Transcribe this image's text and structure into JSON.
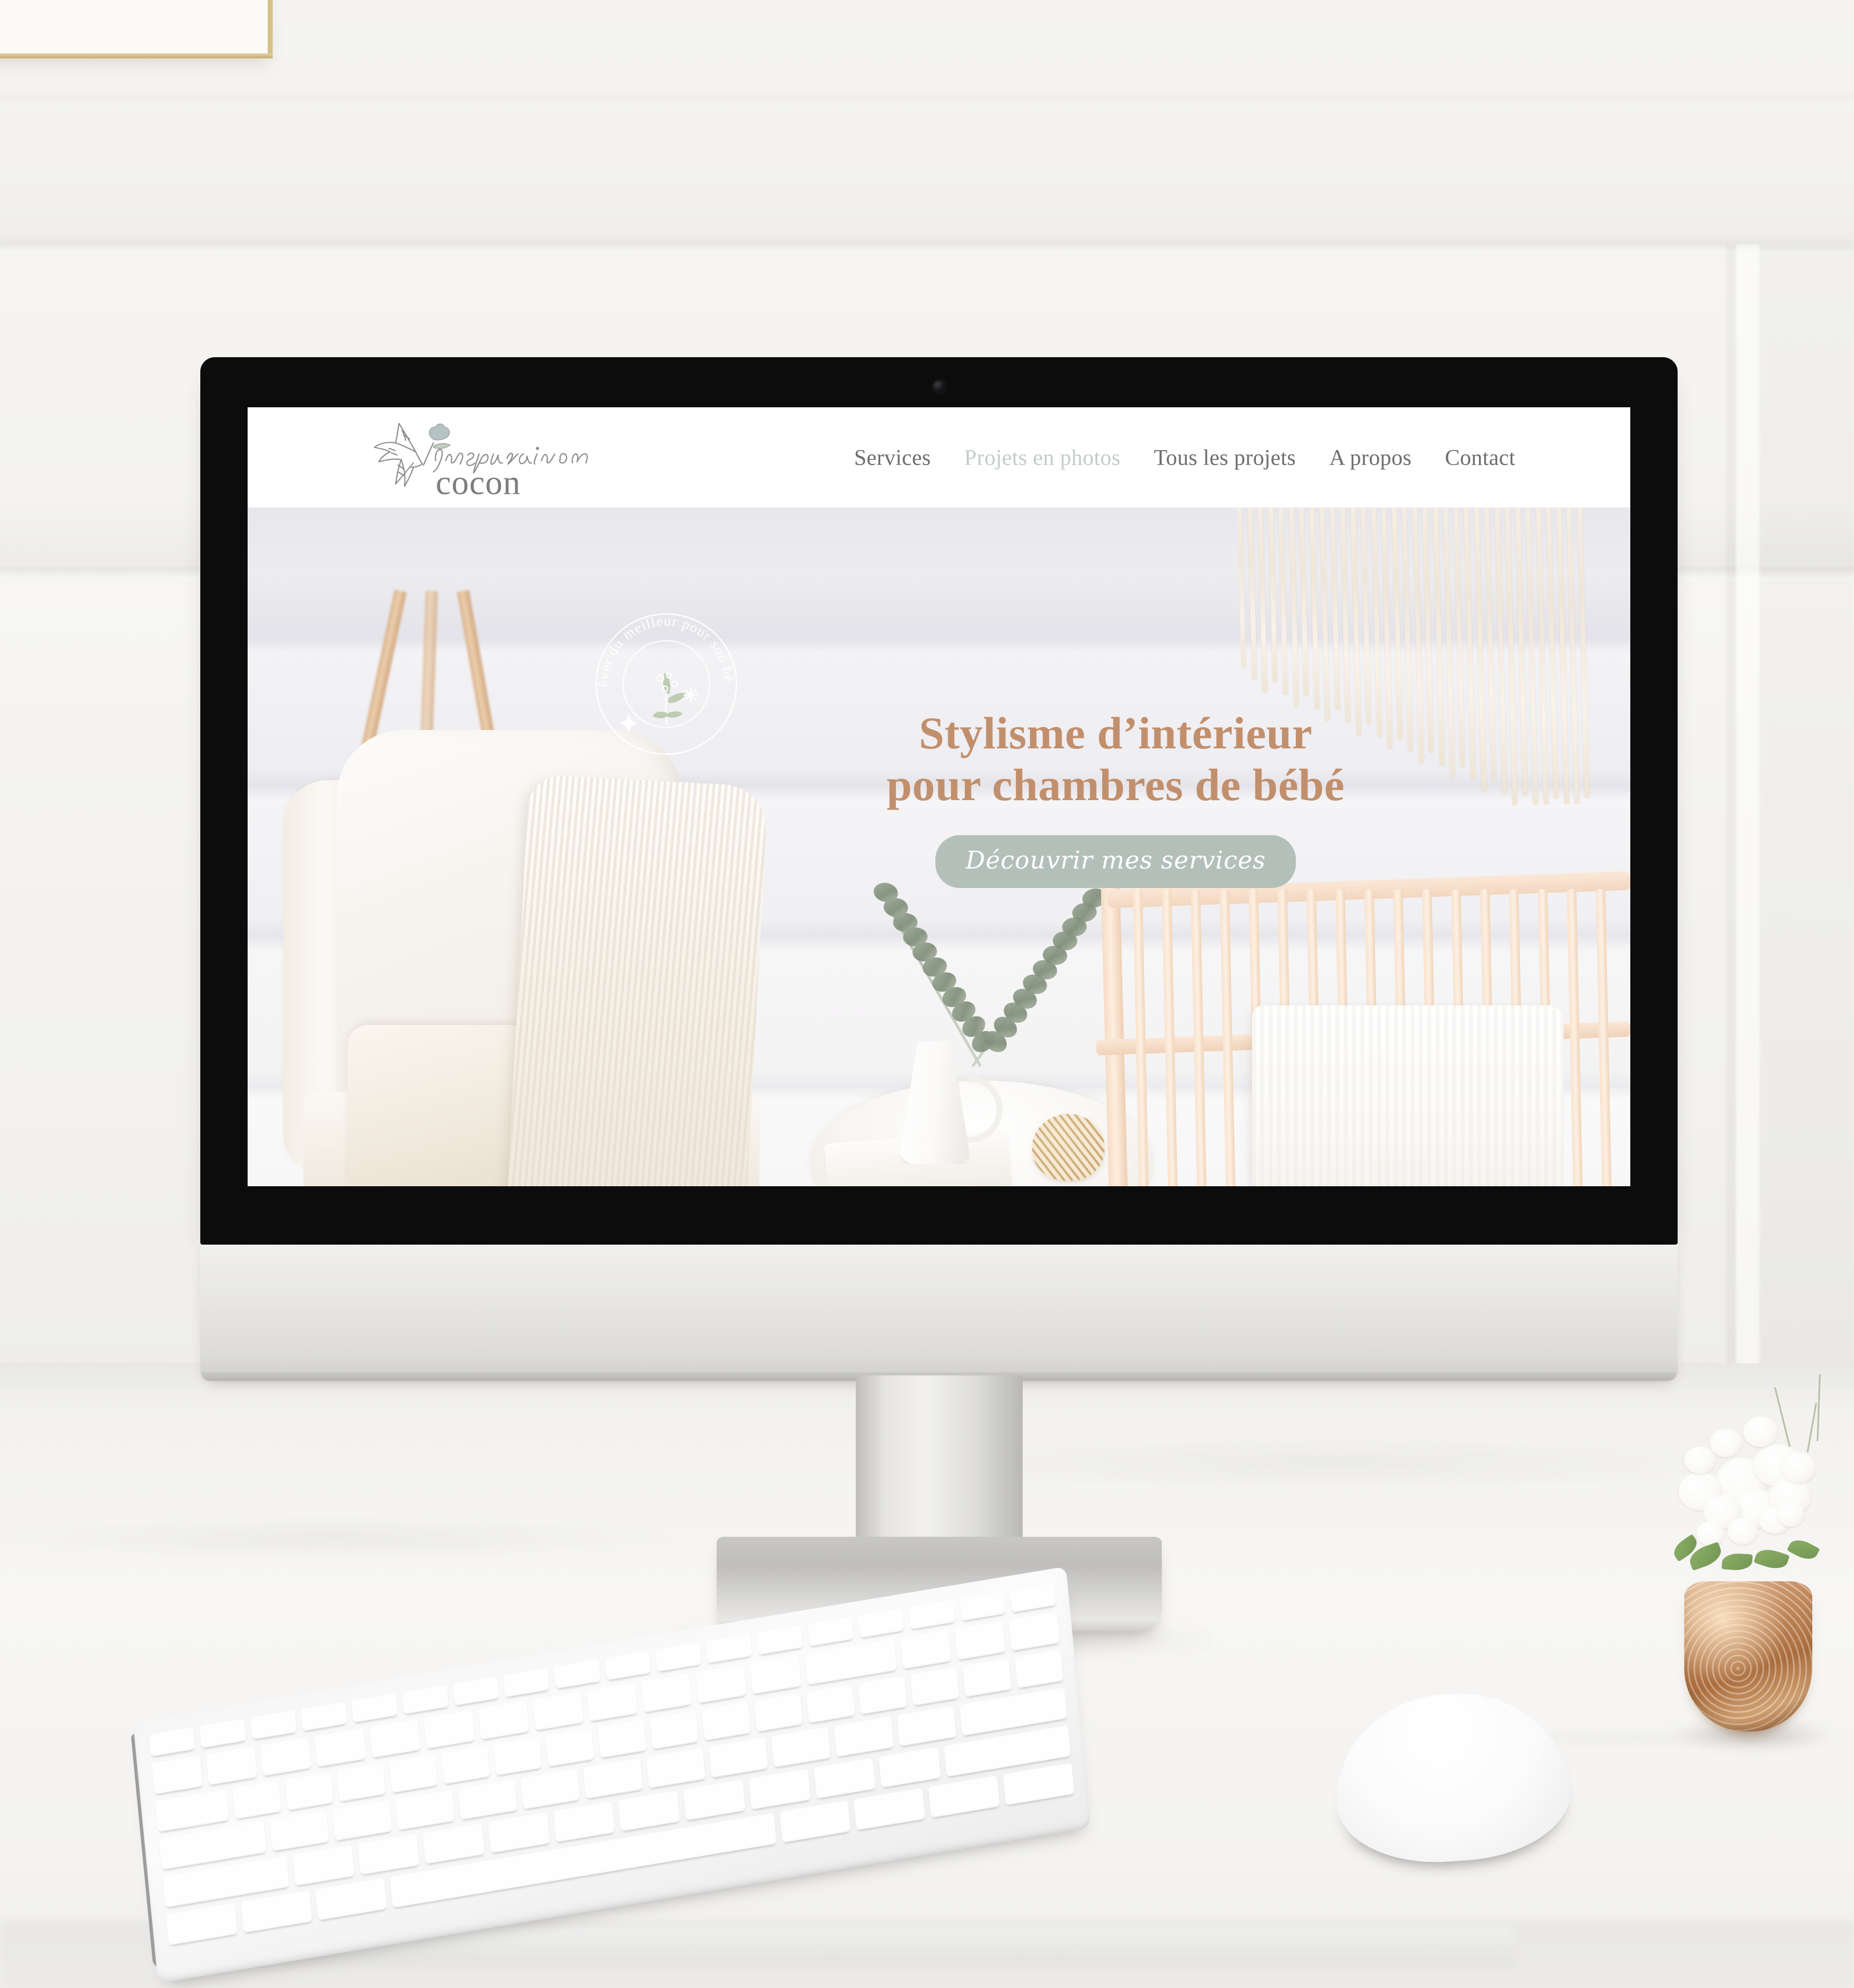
{
  "scene": {
    "device": "imac-desktop-computer",
    "surface": "white-marble-desk",
    "decor": [
      "gold-picture-frame",
      "white-flowers-copper-vase"
    ],
    "peripherals": [
      "apple-wireless-keyboard",
      "apple-magic-mouse"
    ]
  },
  "website": {
    "brand": {
      "script_word": "inspiration",
      "serif_word": "cocon",
      "logo_icon": "dove-with-flower-icon"
    },
    "nav": {
      "items": [
        {
          "label": "Services",
          "state": "default"
        },
        {
          "label": "Projets en photos",
          "state": "muted"
        },
        {
          "label": "Tous les projets",
          "state": "default"
        },
        {
          "label": "A propos",
          "state": "default"
        },
        {
          "label": "Contact",
          "state": "default"
        }
      ]
    },
    "hero": {
      "badge": {
        "circular_text": "Rêver du meilleur pour son bébé",
        "center_icon": "botanical-sprig-icon"
      },
      "title_line1": "Stylisme d’intérieur",
      "title_line2": "pour chambres de bébé",
      "cta_label": "Découvrir mes services",
      "photo_alt": "chambre de bébé — fauteuil, plaid, eucalyptus et lit à barreaux"
    }
  },
  "colors": {
    "hero_title": "#c28f6c",
    "cta_background": "#b2c0b9",
    "cta_text": "#ffffff",
    "nav_default": "#6e6e6e",
    "nav_muted": "#c3cdc8",
    "logo_serif": "#7d7d7d",
    "badge_stroke": "#ffffff",
    "bezel": "#0c0c0d",
    "chin": "#e8e7e5",
    "wall": "#f4f3f0",
    "desk": "#f5f4f2",
    "frame_gold": "#d8c08d",
    "vase_copper": "#b0703f"
  }
}
